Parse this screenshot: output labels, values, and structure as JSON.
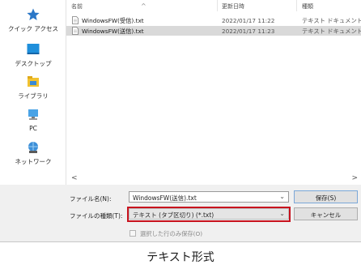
{
  "nav": {
    "items": [
      {
        "label": "クイック アクセス",
        "icon": "star-icon"
      },
      {
        "label": "デスクトップ",
        "icon": "desktop-icon"
      },
      {
        "label": "ライブラリ",
        "icon": "library-icon"
      },
      {
        "label": "PC",
        "icon": "pc-icon"
      },
      {
        "label": "ネットワーク",
        "icon": "network-icon"
      }
    ]
  },
  "list": {
    "columns": {
      "name": "名前",
      "date": "更新日時",
      "type": "種類"
    },
    "rows": [
      {
        "name": "WindowsFW(受信).txt",
        "date": "2022/01/17 11:22",
        "type": "テキスト ドキュメント",
        "selected": false
      },
      {
        "name": "WindowsFW(送信).txt",
        "date": "2022/01/17 11:23",
        "type": "テキスト ドキュメント",
        "selected": true
      }
    ]
  },
  "form": {
    "filename_label": "ファイル名(N):",
    "filename_value": "WindowsFW(送信).txt",
    "filetype_label": "ファイルの種類(T):",
    "filetype_value": "テキスト (タブ区切り) (*.txt)",
    "save_button": "保存(S)",
    "cancel_button": "キャンセル",
    "selected_rows_only": "選択した行のみ保存(O)"
  },
  "caption": "テキスト形式",
  "colors": {
    "highlight_border": "#c8121e",
    "selected_row": "#d9d9d9"
  }
}
